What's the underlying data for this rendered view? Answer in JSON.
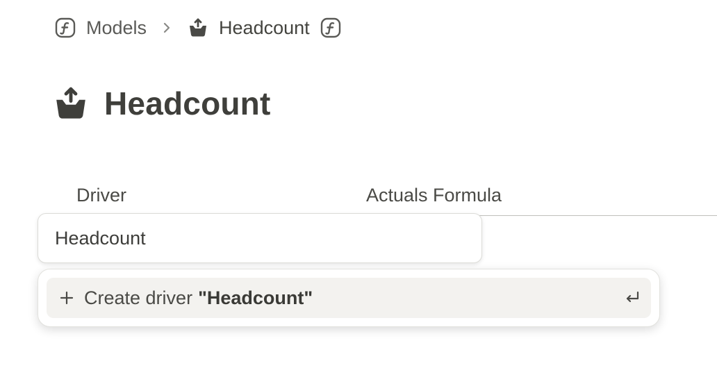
{
  "breadcrumb": {
    "root_label": "Models",
    "root_icon": "formula-icon",
    "current_label": "Headcount",
    "current_icon": "basket-upload-icon",
    "trailing_icon": "formula-icon"
  },
  "page": {
    "title": "Headcount",
    "title_icon": "basket-upload-icon"
  },
  "table": {
    "columns": [
      "Driver",
      "Actuals Formula"
    ]
  },
  "driver_input": {
    "value": "Headcount"
  },
  "dropdown": {
    "option_prefix": "Create driver",
    "option_quoted": "\"Headcount\"",
    "option_icon": "plus-icon",
    "shortcut_icon": "enter-key-icon"
  },
  "colors": {
    "text": "#3d3d3b",
    "option_highlight": "#f3f2ef",
    "border": "#dcdcd8"
  }
}
